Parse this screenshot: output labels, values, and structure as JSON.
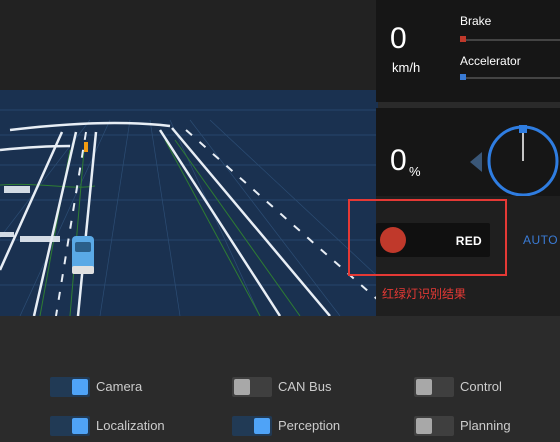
{
  "status": {
    "speed_value": "0",
    "speed_unit": "km/h",
    "brake_label": "Brake",
    "accelerator_label": "Accelerator",
    "brake_level": 0,
    "accelerator_level": 0,
    "steering_value": "0",
    "steering_unit": "%",
    "colors": {
      "brake": "#c0392b",
      "accelerator": "#3a7bd5"
    }
  },
  "traffic_light": {
    "color_label": "RED",
    "color": "#c0392b",
    "annotation": "红绿灯识别结果"
  },
  "driving_mode_label": "AUTO",
  "modules": [
    {
      "label": "Camera",
      "enabled": true
    },
    {
      "label": "CAN Bus",
      "enabled": false
    },
    {
      "label": "Control",
      "enabled": false
    },
    {
      "label": "Localization",
      "enabled": true
    },
    {
      "label": "Perception",
      "enabled": true
    },
    {
      "label": "Planning",
      "enabled": false
    }
  ]
}
